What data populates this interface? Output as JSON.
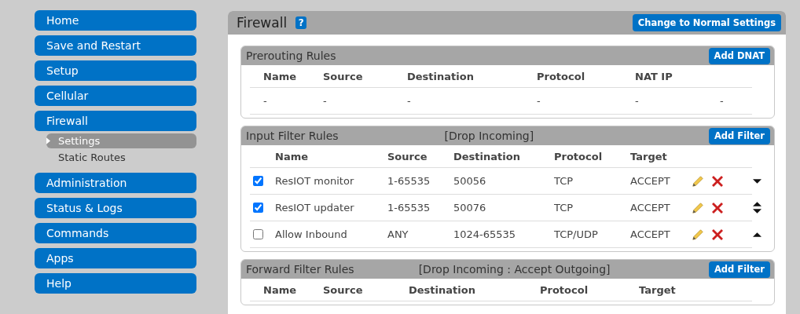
{
  "sidebar": {
    "items": [
      {
        "label": "Home",
        "selected": false
      },
      {
        "label": "Save and Restart",
        "selected": false
      },
      {
        "label": "Setup",
        "selected": false
      },
      {
        "label": "Cellular",
        "selected": false
      },
      {
        "label": "Firewall",
        "selected": false,
        "children": [
          {
            "label": "Settings",
            "selected": true
          },
          {
            "label": "Static Routes",
            "selected": false
          }
        ]
      },
      {
        "label": "Administration",
        "selected": false
      },
      {
        "label": "Status & Logs",
        "selected": false
      },
      {
        "label": "Commands",
        "selected": false
      },
      {
        "label": "Apps",
        "selected": false
      },
      {
        "label": "Help",
        "selected": false
      }
    ]
  },
  "panel": {
    "title": "Firewall",
    "help": "?",
    "button": "Change to Normal Settings",
    "sections": [
      {
        "kind": "prerouting",
        "title": "Prerouting Rules",
        "button": "Add DNAT",
        "columns": [
          "Name",
          "Source",
          "Destination",
          "Protocol",
          "NAT IP"
        ],
        "rows": [
          {
            "cells": [
              "-",
              "-",
              "-",
              "-",
              "-",
              "-"
            ]
          }
        ]
      },
      {
        "kind": "input",
        "title": "Input Filter Rules",
        "policy": "[Drop Incoming]",
        "button": "Add Filter",
        "columns": [
          "Name",
          "Source",
          "Destination",
          "Protocol",
          "Target"
        ],
        "rows": [
          {
            "checked": true,
            "cells": [
              "ResIOT monitor",
              "1-65535",
              "50056",
              "TCP",
              "ACCEPT"
            ],
            "move_up": false,
            "move_down": true
          },
          {
            "checked": true,
            "cells": [
              "ResIOT updater",
              "1-65535",
              "50076",
              "TCP",
              "ACCEPT"
            ],
            "move_up": true,
            "move_down": true
          },
          {
            "checked": false,
            "cells": [
              "Allow Inbound",
              "ANY",
              "1024-65535",
              "TCP/UDP",
              "ACCEPT"
            ],
            "move_up": true,
            "move_down": false
          }
        ]
      },
      {
        "kind": "forward",
        "title": "Forward Filter Rules",
        "policy": "[Drop Incoming : Accept Outgoing]",
        "button": "Add Filter",
        "columns": [
          "Name",
          "Source",
          "Destination",
          "Protocol",
          "Target"
        ]
      }
    ]
  }
}
